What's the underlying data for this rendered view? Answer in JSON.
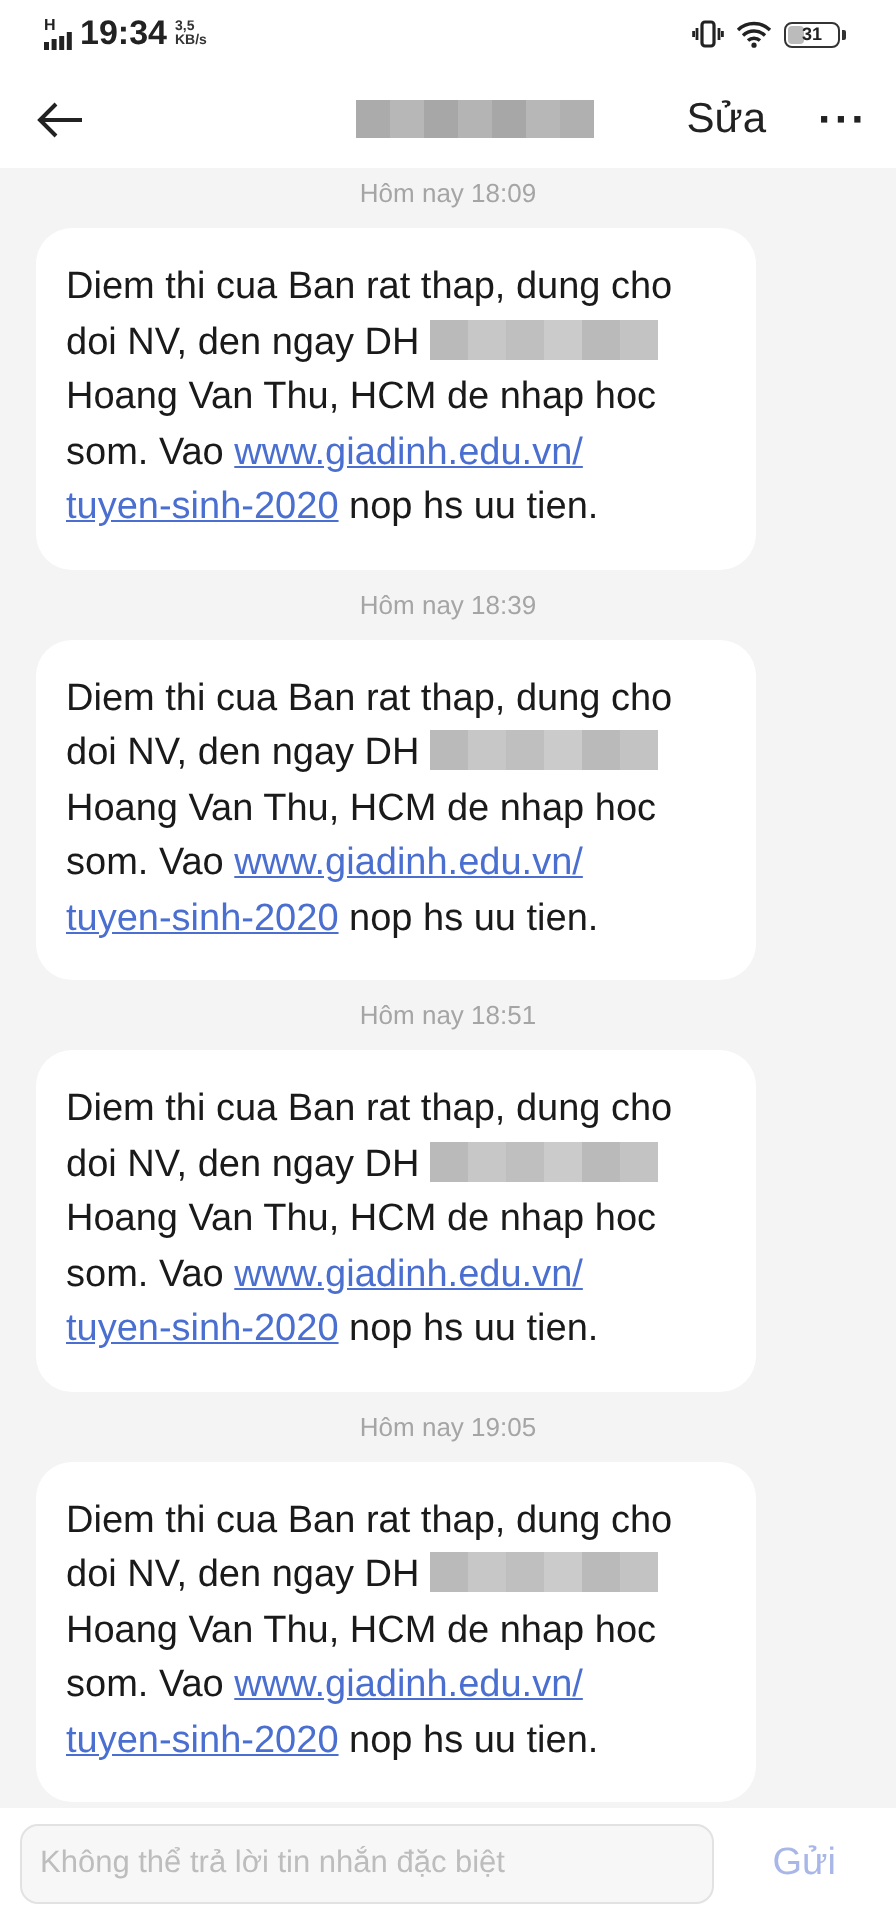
{
  "status_bar": {
    "network": "H",
    "time": "19:34",
    "speed_value": "3,5",
    "speed_unit": "KB/s",
    "battery": "31"
  },
  "header": {
    "action": "Sửa",
    "more": "···"
  },
  "messages": [
    {
      "timestamp": "Hôm nay 18:09",
      "text_before": "Diem thi cua Ban rat thap, dung cho doi NV, den ngay DH",
      "text_middle": "Hoang Van Thu, HCM de nhap hoc som. Vao",
      "link_lines": [
        "www.giadinh.edu.vn/",
        "tuyen-sinh-2020"
      ],
      "text_after": "nop hs uu tien."
    },
    {
      "timestamp": "Hôm nay 18:39",
      "text_before": "Diem thi cua Ban rat thap, dung cho doi NV, den ngay DH",
      "text_middle": "Hoang Van Thu, HCM de nhap hoc som. Vao",
      "link_lines": [
        "www.giadinh.edu.vn/",
        "tuyen-sinh-2020"
      ],
      "text_after": "nop hs uu tien."
    },
    {
      "timestamp": "Hôm nay 18:51",
      "text_before": "Diem thi cua Ban rat thap, dung cho doi NV, den ngay DH",
      "text_middle": "Hoang Van Thu, HCM de nhap hoc som. Vao",
      "link_lines": [
        "www.giadinh.edu.vn/",
        "tuyen-sinh-2020"
      ],
      "text_after": "nop hs uu tien."
    },
    {
      "timestamp": "Hôm nay 19:05",
      "text_before": "Diem thi cua Ban rat thap, dung cho doi NV, den ngay DH",
      "text_middle": "Hoang Van Thu, HCM de nhap hoc som. Vao",
      "link_lines": [
        "www.giadinh.edu.vn/",
        "tuyen-sinh-2020"
      ],
      "text_after": "nop hs uu tien."
    }
  ],
  "composer": {
    "placeholder": "Không thể trả lời tin nhắn đặc biệt",
    "send": "Gửi"
  }
}
